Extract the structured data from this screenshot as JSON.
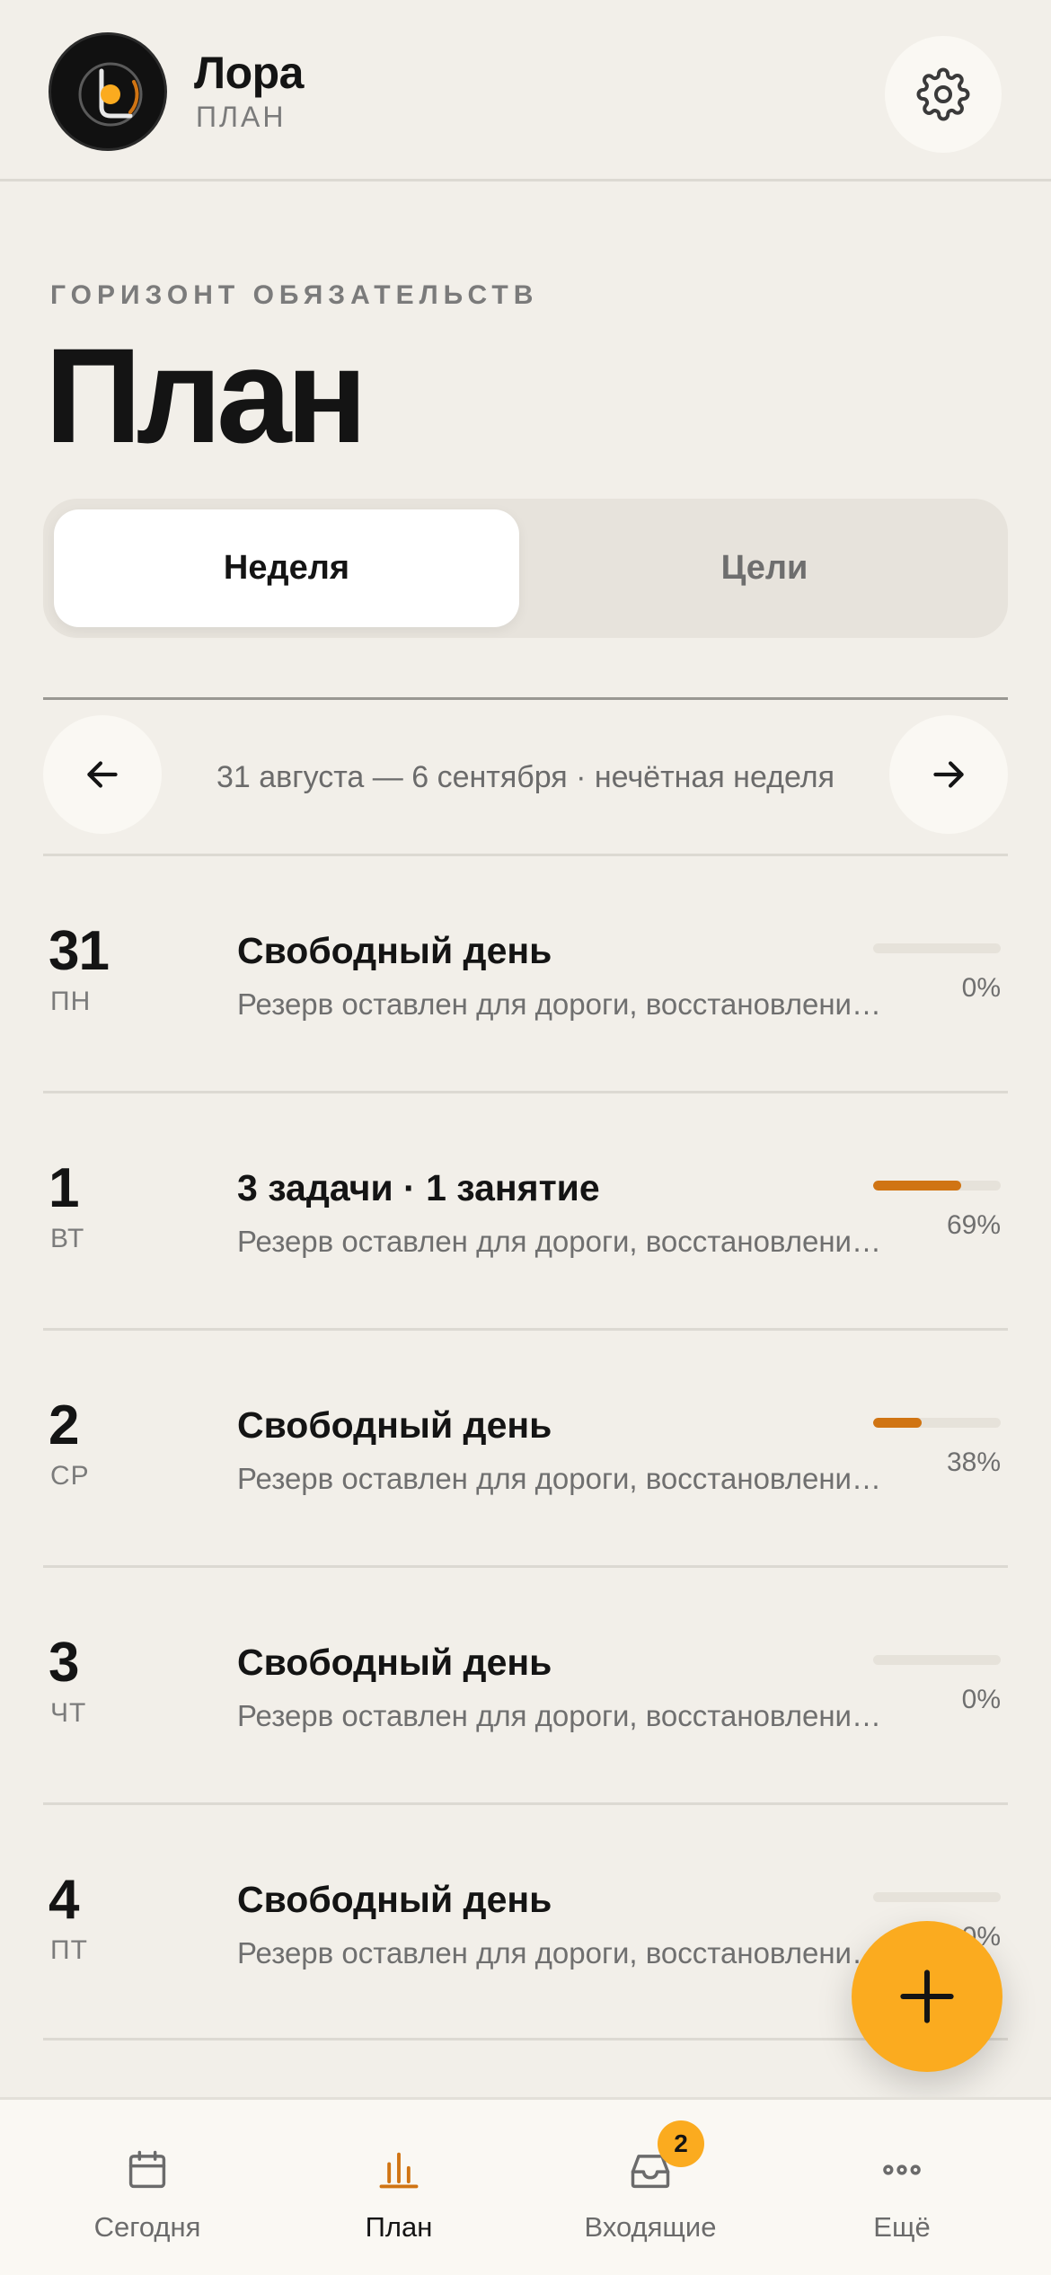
{
  "header": {
    "brand_name": "Лора",
    "brand_sub": "ПЛАН",
    "logo_icon": "lora-logo-icon",
    "settings_icon": "gear-icon"
  },
  "page": {
    "eyebrow": "ГОРИЗОНТ ОБЯЗАТЕЛЬСТВ",
    "title": "План"
  },
  "segmented": {
    "tabs": [
      {
        "label": "Неделя",
        "active": true
      },
      {
        "label": "Цели",
        "active": false
      }
    ]
  },
  "week_nav": {
    "label": "31 августа — 6 сентября · нечётная неделя",
    "prev_icon": "arrow-left-icon",
    "next_icon": "arrow-right-icon"
  },
  "days": [
    {
      "num": "31",
      "weekday": "ПН",
      "title": "Свободный день",
      "desc": "Резерв оставлен для дороги, восстановления и отдыха",
      "progress": 0,
      "progress_label": "0%"
    },
    {
      "num": "1",
      "weekday": "ВТ",
      "title": "3 задачи · 1 занятие",
      "desc": "Резерв оставлен для дороги, восстановления и отдыха",
      "progress": 69,
      "progress_label": "69%"
    },
    {
      "num": "2",
      "weekday": "СР",
      "title": "Свободный день",
      "desc": "Резерв оставлен для дороги, восстановления и отдыха",
      "progress": 38,
      "progress_label": "38%"
    },
    {
      "num": "3",
      "weekday": "ЧТ",
      "title": "Свободный день",
      "desc": "Резерв оставлен для дороги, восстановления и отдыха",
      "progress": 0,
      "progress_label": "0%"
    },
    {
      "num": "4",
      "weekday": "ПТ",
      "title": "Свободный день",
      "desc": "Резерв оставлен для дороги, восстановления и отдыха",
      "progress": 0,
      "progress_label": "0%"
    }
  ],
  "fab": {
    "icon": "plus-icon"
  },
  "tabbar": {
    "items": [
      {
        "label": "Сегодня",
        "icon": "calendar-icon",
        "active": false
      },
      {
        "label": "План",
        "icon": "bar-chart-icon",
        "active": true
      },
      {
        "label": "Входящие",
        "icon": "inbox-icon",
        "active": false
      },
      {
        "label": "Ещё",
        "icon": "more-dots-icon",
        "active": false
      }
    ],
    "inbox_badge": "2"
  },
  "colors": {
    "background": "#f2efe9",
    "accent": "#d07413",
    "fab": "#fbab1f",
    "text": "#141414",
    "muted": "#7b7b7b"
  }
}
